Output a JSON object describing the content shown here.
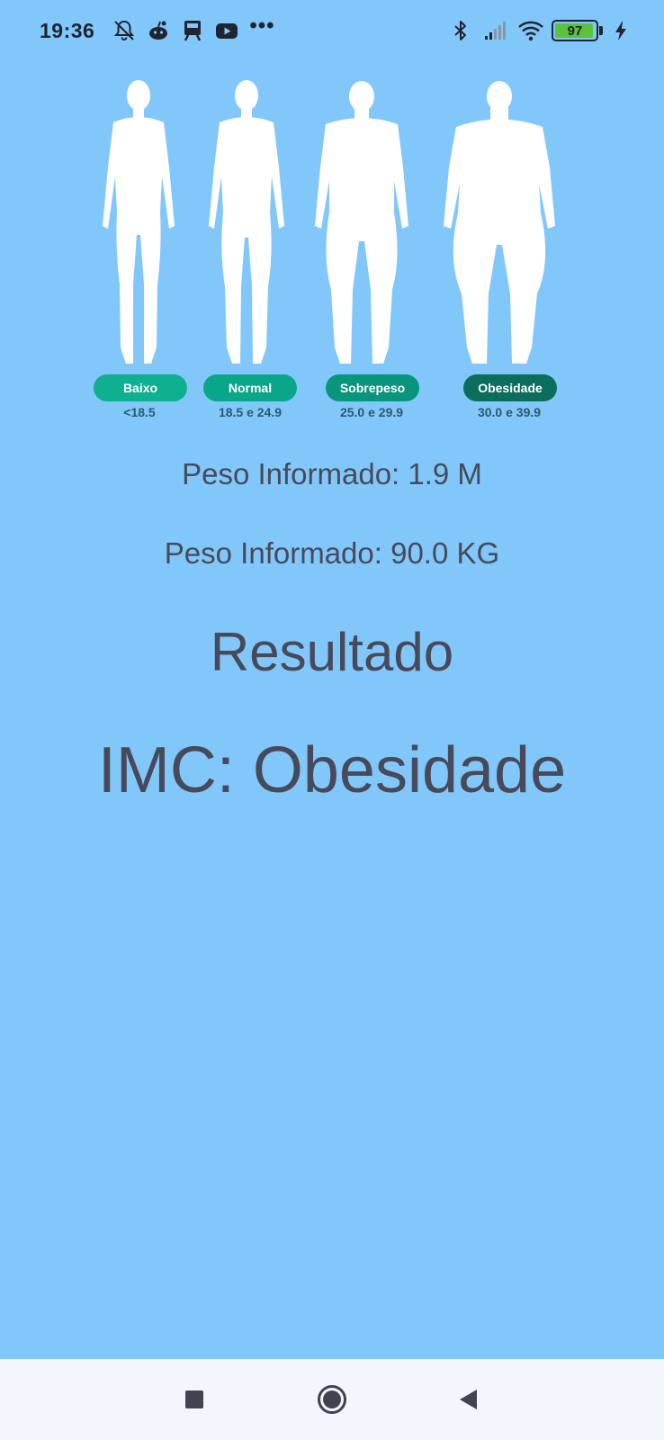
{
  "status_bar": {
    "time": "19:36",
    "left_icons": [
      "bell-off-icon",
      "reddit-icon",
      "train-icon",
      "youtube-icon"
    ],
    "more": "•••",
    "right_icons": [
      "bluetooth-icon",
      "signal-icon",
      "wifi-icon"
    ],
    "battery_level": "97",
    "charging": true
  },
  "bmi_categories": [
    {
      "label": "Baixo",
      "range": "<18.5",
      "color": "#0fb090"
    },
    {
      "label": "Normal",
      "range": "18.5 e 24.9",
      "color": "#0aa689"
    },
    {
      "label": "Sobrepeso",
      "range": "25.0 e 29.9",
      "color": "#08957c"
    },
    {
      "label": "Obesidade",
      "range": "30.0 e 39.9",
      "color": "#0b6e5c"
    }
  ],
  "info": {
    "height_text": "Peso Informado: 1.9 M",
    "weight_text": "Peso Informado: 90.0 KG"
  },
  "result": {
    "title": "Resultado",
    "value": "IMC: Obesidade"
  },
  "nav_bar": {
    "buttons": [
      "recent-apps",
      "home",
      "back"
    ]
  },
  "colors": {
    "background": "#82c7fa",
    "text": "#474a5a",
    "nav_background": "#f2f7fd"
  }
}
